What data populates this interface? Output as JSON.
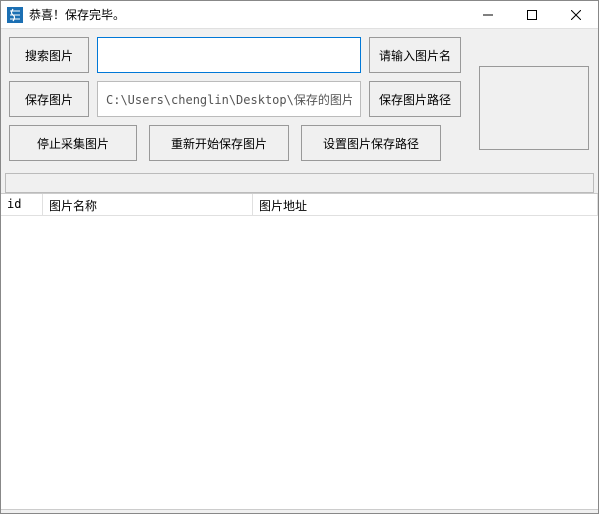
{
  "window": {
    "title": "恭喜！保存完毕。"
  },
  "buttons": {
    "search_image": "搜索图片",
    "input_image_name": "请输入图片名",
    "save_image": "保存图片",
    "save_image_path": "保存图片路径",
    "stop_collect": "停止采集图片",
    "restart_save": "重新开始保存图片",
    "set_save_path": "设置图片保存路径"
  },
  "inputs": {
    "search_value": "",
    "path_value": "C:\\Users\\chenglin\\Desktop\\保存的图片"
  },
  "table": {
    "columns": {
      "id": "id",
      "name": "图片名称",
      "addr": "图片地址"
    },
    "rows": []
  }
}
